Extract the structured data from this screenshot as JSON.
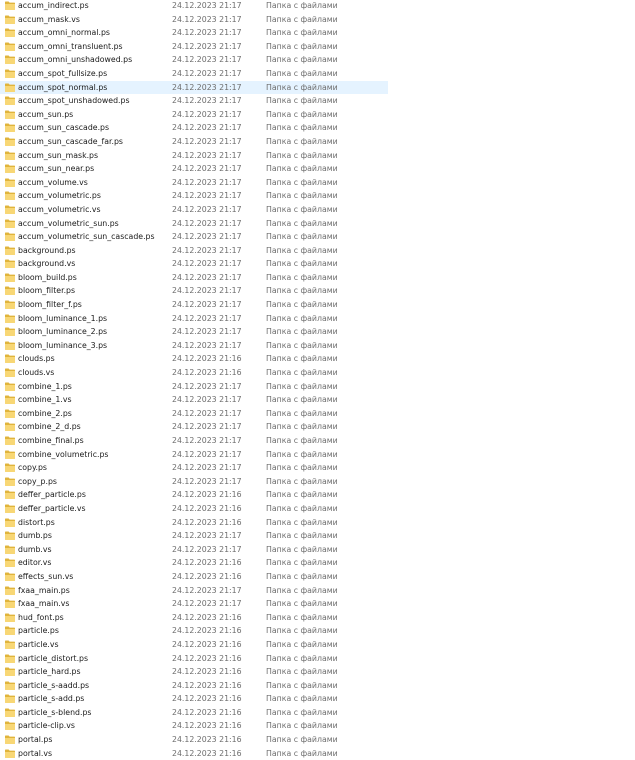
{
  "colors": {
    "folder_yellow": "#f8d775",
    "folder_dark": "#e0b43c",
    "selection": "#e5f3ff"
  },
  "icon": "folder-icon",
  "files": [
    {
      "name": "accum_indirect.ps",
      "date": "24.12.2023 21:17",
      "type": "Папка с файлами"
    },
    {
      "name": "accum_mask.vs",
      "date": "24.12.2023 21:17",
      "type": "Папка с файлами"
    },
    {
      "name": "accum_omni_normal.ps",
      "date": "24.12.2023 21:17",
      "type": "Папка с файлами"
    },
    {
      "name": "accum_omni_transluent.ps",
      "date": "24.12.2023 21:17",
      "type": "Папка с файлами"
    },
    {
      "name": "accum_omni_unshadowed.ps",
      "date": "24.12.2023 21:17",
      "type": "Папка с файлами"
    },
    {
      "name": "accum_spot_fullsize.ps",
      "date": "24.12.2023 21:17",
      "type": "Папка с файлами"
    },
    {
      "name": "accum_spot_normal.ps",
      "date": "24.12.2023 21:17",
      "type": "Папка с файлами",
      "selected": true
    },
    {
      "name": "accum_spot_unshadowed.ps",
      "date": "24.12.2023 21:17",
      "type": "Папка с файлами"
    },
    {
      "name": "accum_sun.ps",
      "date": "24.12.2023 21:17",
      "type": "Папка с файлами"
    },
    {
      "name": "accum_sun_cascade.ps",
      "date": "24.12.2023 21:17",
      "type": "Папка с файлами"
    },
    {
      "name": "accum_sun_cascade_far.ps",
      "date": "24.12.2023 21:17",
      "type": "Папка с файлами"
    },
    {
      "name": "accum_sun_mask.ps",
      "date": "24.12.2023 21:17",
      "type": "Папка с файлами"
    },
    {
      "name": "accum_sun_near.ps",
      "date": "24.12.2023 21:17",
      "type": "Папка с файлами"
    },
    {
      "name": "accum_volume.vs",
      "date": "24.12.2023 21:17",
      "type": "Папка с файлами"
    },
    {
      "name": "accum_volumetric.ps",
      "date": "24.12.2023 21:17",
      "type": "Папка с файлами"
    },
    {
      "name": "accum_volumetric.vs",
      "date": "24.12.2023 21:17",
      "type": "Папка с файлами"
    },
    {
      "name": "accum_volumetric_sun.ps",
      "date": "24.12.2023 21:17",
      "type": "Папка с файлами"
    },
    {
      "name": "accum_volumetric_sun_cascade.ps",
      "date": "24.12.2023 21:17",
      "type": "Папка с файлами"
    },
    {
      "name": "background.ps",
      "date": "24.12.2023 21:17",
      "type": "Папка с файлами"
    },
    {
      "name": "background.vs",
      "date": "24.12.2023 21:17",
      "type": "Папка с файлами"
    },
    {
      "name": "bloom_build.ps",
      "date": "24.12.2023 21:17",
      "type": "Папка с файлами"
    },
    {
      "name": "bloom_filter.ps",
      "date": "24.12.2023 21:17",
      "type": "Папка с файлами"
    },
    {
      "name": "bloom_filter_f.ps",
      "date": "24.12.2023 21:17",
      "type": "Папка с файлами"
    },
    {
      "name": "bloom_luminance_1.ps",
      "date": "24.12.2023 21:17",
      "type": "Папка с файлами"
    },
    {
      "name": "bloom_luminance_2.ps",
      "date": "24.12.2023 21:17",
      "type": "Папка с файлами"
    },
    {
      "name": "bloom_luminance_3.ps",
      "date": "24.12.2023 21:17",
      "type": "Папка с файлами"
    },
    {
      "name": "clouds.ps",
      "date": "24.12.2023 21:16",
      "type": "Папка с файлами"
    },
    {
      "name": "clouds.vs",
      "date": "24.12.2023 21:16",
      "type": "Папка с файлами"
    },
    {
      "name": "combine_1.ps",
      "date": "24.12.2023 21:17",
      "type": "Папка с файлами"
    },
    {
      "name": "combine_1.vs",
      "date": "24.12.2023 21:17",
      "type": "Папка с файлами"
    },
    {
      "name": "combine_2.ps",
      "date": "24.12.2023 21:17",
      "type": "Папка с файлами"
    },
    {
      "name": "combine_2_d.ps",
      "date": "24.12.2023 21:17",
      "type": "Папка с файлами"
    },
    {
      "name": "combine_final.ps",
      "date": "24.12.2023 21:17",
      "type": "Папка с файлами"
    },
    {
      "name": "combine_volumetric.ps",
      "date": "24.12.2023 21:17",
      "type": "Папка с файлами"
    },
    {
      "name": "copy.ps",
      "date": "24.12.2023 21:17",
      "type": "Папка с файлами"
    },
    {
      "name": "copy_p.ps",
      "date": "24.12.2023 21:17",
      "type": "Папка с файлами"
    },
    {
      "name": "deffer_particle.ps",
      "date": "24.12.2023 21:16",
      "type": "Папка с файлами"
    },
    {
      "name": "deffer_particle.vs",
      "date": "24.12.2023 21:16",
      "type": "Папка с файлами"
    },
    {
      "name": "distort.ps",
      "date": "24.12.2023 21:16",
      "type": "Папка с файлами"
    },
    {
      "name": "dumb.ps",
      "date": "24.12.2023 21:17",
      "type": "Папка с файлами"
    },
    {
      "name": "dumb.vs",
      "date": "24.12.2023 21:17",
      "type": "Папка с файлами"
    },
    {
      "name": "editor.vs",
      "date": "24.12.2023 21:16",
      "type": "Папка с файлами"
    },
    {
      "name": "effects_sun.vs",
      "date": "24.12.2023 21:16",
      "type": "Папка с файлами"
    },
    {
      "name": "fxaa_main.ps",
      "date": "24.12.2023 21:17",
      "type": "Папка с файлами"
    },
    {
      "name": "fxaa_main.vs",
      "date": "24.12.2023 21:17",
      "type": "Папка с файлами"
    },
    {
      "name": "hud_font.ps",
      "date": "24.12.2023 21:16",
      "type": "Папка с файлами"
    },
    {
      "name": "particle.ps",
      "date": "24.12.2023 21:16",
      "type": "Папка с файлами"
    },
    {
      "name": "particle.vs",
      "date": "24.12.2023 21:16",
      "type": "Папка с файлами"
    },
    {
      "name": "particle_distort.ps",
      "date": "24.12.2023 21:16",
      "type": "Папка с файлами"
    },
    {
      "name": "particle_hard.ps",
      "date": "24.12.2023 21:16",
      "type": "Папка с файлами"
    },
    {
      "name": "particle_s-aadd.ps",
      "date": "24.12.2023 21:16",
      "type": "Папка с файлами"
    },
    {
      "name": "particle_s-add.ps",
      "date": "24.12.2023 21:16",
      "type": "Папка с файлами"
    },
    {
      "name": "particle_s-blend.ps",
      "date": "24.12.2023 21:16",
      "type": "Папка с файлами"
    },
    {
      "name": "particle-clip.vs",
      "date": "24.12.2023 21:16",
      "type": "Папка с файлами"
    },
    {
      "name": "portal.ps",
      "date": "24.12.2023 21:16",
      "type": "Папка с файлами"
    },
    {
      "name": "portal.vs",
      "date": "24.12.2023 21:16",
      "type": "Папка с файлами"
    }
  ]
}
